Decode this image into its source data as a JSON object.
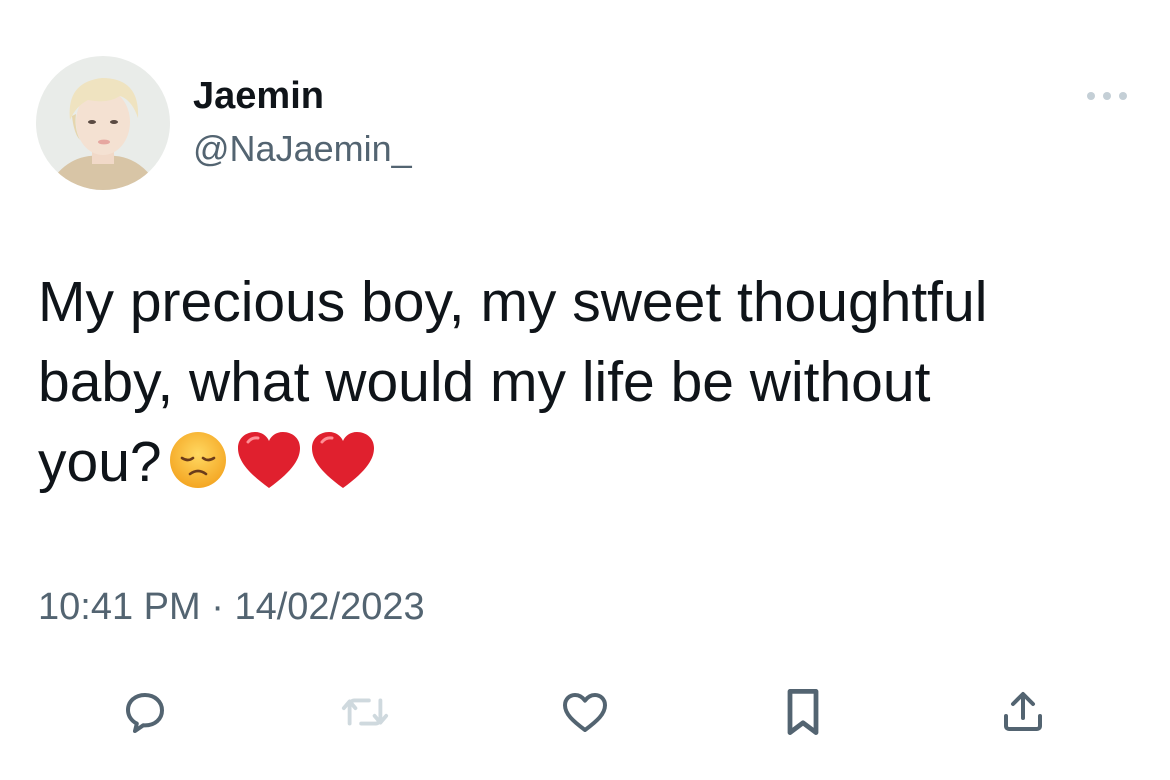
{
  "tweet": {
    "author": {
      "display_name": "Jaemin",
      "handle": "@NaJaemin_",
      "avatar": "avatar-photo"
    },
    "text_line1": "My precious boy, my sweet thoughtful",
    "text_line2": "baby, what would my life be without",
    "text_line3": "you?",
    "emojis": [
      "disappointed-face",
      "red-heart",
      "red-heart"
    ],
    "time": "10:41 PM",
    "separator": "·",
    "date": "14/02/2023"
  },
  "actions": [
    {
      "name": "reply",
      "icon": "speech-bubble-icon"
    },
    {
      "name": "retweet",
      "icon": "retweet-icon",
      "state": "disabled"
    },
    {
      "name": "like",
      "icon": "heart-icon"
    },
    {
      "name": "bookmark",
      "icon": "bookmark-icon"
    },
    {
      "name": "share",
      "icon": "share-icon"
    }
  ],
  "colors": {
    "text_primary": "#0f1419",
    "text_secondary": "#536471",
    "icon_default": "#536471",
    "icon_disabled": "#cfd9de",
    "heart_emoji": "#e0202e",
    "face_emoji": "#f7b731"
  }
}
